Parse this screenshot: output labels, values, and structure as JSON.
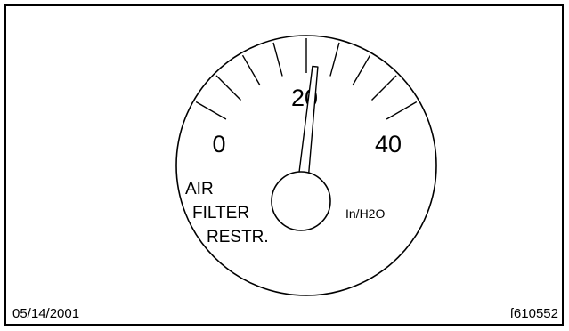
{
  "gauge": {
    "scale_labels": [
      "0",
      "20",
      "40"
    ],
    "label_lines": [
      "AIR",
      "FILTER",
      "RESTR."
    ],
    "unit": "In/H2O",
    "needle_value": 22
  },
  "footer": {
    "date": "05/14/2001",
    "figure_id": "f610552"
  }
}
